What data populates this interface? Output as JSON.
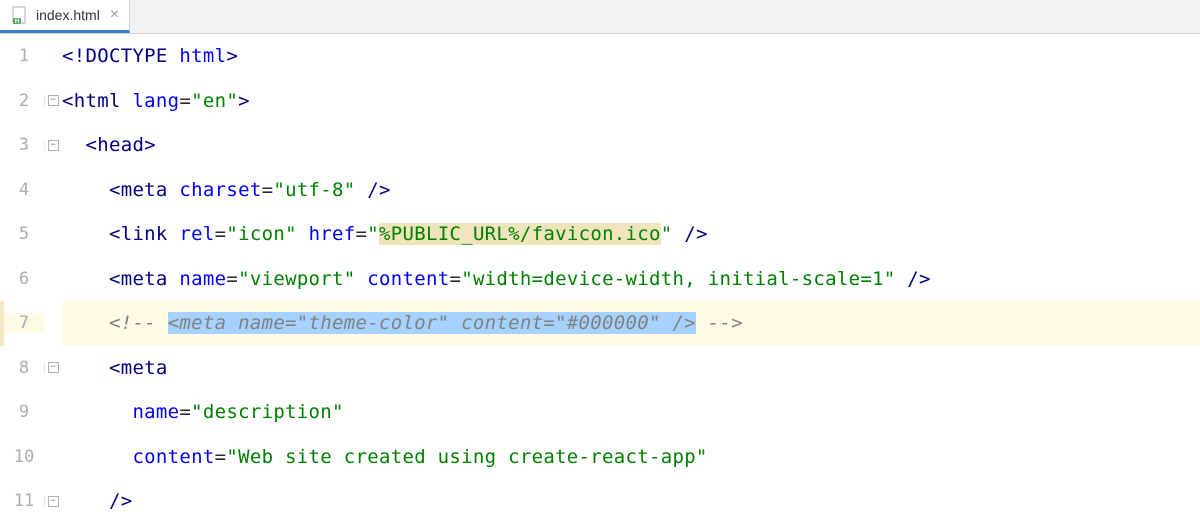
{
  "tab": {
    "filename": "index.html",
    "close": "×"
  },
  "gutter": {
    "fold_symbol": "−"
  },
  "lines": [
    {
      "num": "1",
      "fold": false,
      "segments": [
        {
          "text": "<!",
          "cls": "c-tag"
        },
        {
          "text": "DOCTYPE ",
          "cls": "c-tag"
        },
        {
          "text": "html",
          "cls": "c-attr"
        },
        {
          "text": ">",
          "cls": "c-tag"
        }
      ]
    },
    {
      "num": "2",
      "fold": true,
      "segments": [
        {
          "text": "<html ",
          "cls": "c-tag"
        },
        {
          "text": "lang",
          "cls": "c-attr"
        },
        {
          "text": "=",
          "cls": "c-punct"
        },
        {
          "text": "\"en\"",
          "cls": "c-str"
        },
        {
          "text": ">",
          "cls": "c-tag"
        }
      ]
    },
    {
      "num": "3",
      "fold": true,
      "indent": 1,
      "segments": [
        {
          "text": "<head>",
          "cls": "c-tag"
        }
      ]
    },
    {
      "num": "4",
      "fold": false,
      "indent": 2,
      "segments": [
        {
          "text": "<meta ",
          "cls": "c-tag"
        },
        {
          "text": "charset",
          "cls": "c-attr"
        },
        {
          "text": "=",
          "cls": "c-punct"
        },
        {
          "text": "\"utf-8\"",
          "cls": "c-str"
        },
        {
          "text": " />",
          "cls": "c-tag"
        }
      ]
    },
    {
      "num": "5",
      "fold": false,
      "indent": 2,
      "segments": [
        {
          "text": "<link ",
          "cls": "c-tag"
        },
        {
          "text": "rel",
          "cls": "c-attr"
        },
        {
          "text": "=",
          "cls": "c-punct"
        },
        {
          "text": "\"icon\"",
          "cls": "c-str"
        },
        {
          "text": " ",
          "cls": "c-text"
        },
        {
          "text": "href",
          "cls": "c-attr"
        },
        {
          "text": "=",
          "cls": "c-punct"
        },
        {
          "text": "\"",
          "cls": "c-str"
        },
        {
          "text": "%PUBLIC_URL%/favicon.ico",
          "cls": "c-str hl-yellow"
        },
        {
          "text": "\"",
          "cls": "c-str"
        },
        {
          "text": " />",
          "cls": "c-tag"
        }
      ]
    },
    {
      "num": "6",
      "fold": false,
      "indent": 2,
      "segments": [
        {
          "text": "<meta ",
          "cls": "c-tag"
        },
        {
          "text": "name",
          "cls": "c-attr"
        },
        {
          "text": "=",
          "cls": "c-punct"
        },
        {
          "text": "\"viewport\"",
          "cls": "c-str"
        },
        {
          "text": " ",
          "cls": "c-text"
        },
        {
          "text": "content",
          "cls": "c-attr"
        },
        {
          "text": "=",
          "cls": "c-punct"
        },
        {
          "text": "\"width=device-width, initial-scale=1\"",
          "cls": "c-str"
        },
        {
          "text": " />",
          "cls": "c-tag"
        }
      ]
    },
    {
      "num": "7",
      "fold": false,
      "highlighted": true,
      "indent": 2,
      "segments": [
        {
          "text": "<!-- ",
          "cls": "c-comment"
        },
        {
          "text": "<meta name=\"theme-color\" content=\"#000000\" />",
          "cls": "c-comment hl-blue"
        },
        {
          "text": " -->",
          "cls": "c-comment"
        }
      ]
    },
    {
      "num": "8",
      "fold": true,
      "indent": 2,
      "segments": [
        {
          "text": "<meta",
          "cls": "c-tag"
        }
      ]
    },
    {
      "num": "9",
      "fold": false,
      "indent": 3,
      "segments": [
        {
          "text": "name",
          "cls": "c-attr"
        },
        {
          "text": "=",
          "cls": "c-punct"
        },
        {
          "text": "\"description\"",
          "cls": "c-str"
        }
      ]
    },
    {
      "num": "10",
      "fold": false,
      "indent": 3,
      "segments": [
        {
          "text": "content",
          "cls": "c-attr"
        },
        {
          "text": "=",
          "cls": "c-punct"
        },
        {
          "text": "\"Web site created using create-react-app\"",
          "cls": "c-str"
        }
      ]
    },
    {
      "num": "11",
      "fold": true,
      "indent": 2,
      "segments": [
        {
          "text": "/>",
          "cls": "c-tag"
        }
      ]
    }
  ]
}
